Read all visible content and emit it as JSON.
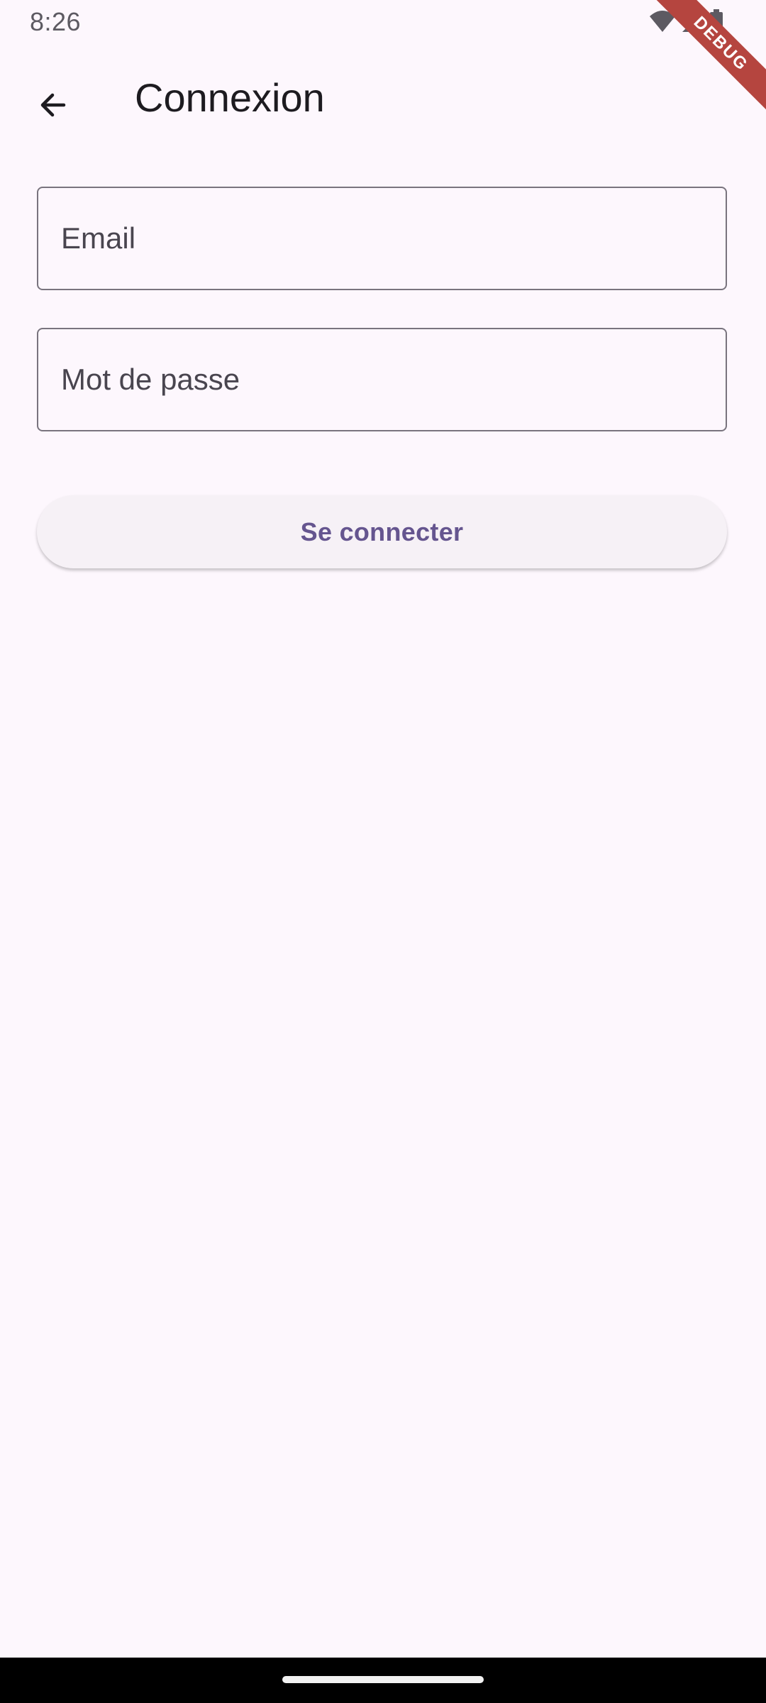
{
  "status_bar": {
    "time": "8:26",
    "icons": [
      "wifi-icon",
      "cell-signal-icon",
      "battery-icon"
    ]
  },
  "debug_banner": "DEBUG",
  "app_bar": {
    "title": "Connexion",
    "back_icon": "arrow-back-icon"
  },
  "form": {
    "email": {
      "placeholder": "Email",
      "value": ""
    },
    "password": {
      "placeholder": "Mot de passe",
      "value": ""
    },
    "submit_label": "Se connecter"
  },
  "colors": {
    "background": "#fdf7fd",
    "accent": "#65558f",
    "outline": "#79747e",
    "debug": "#b5453f"
  }
}
